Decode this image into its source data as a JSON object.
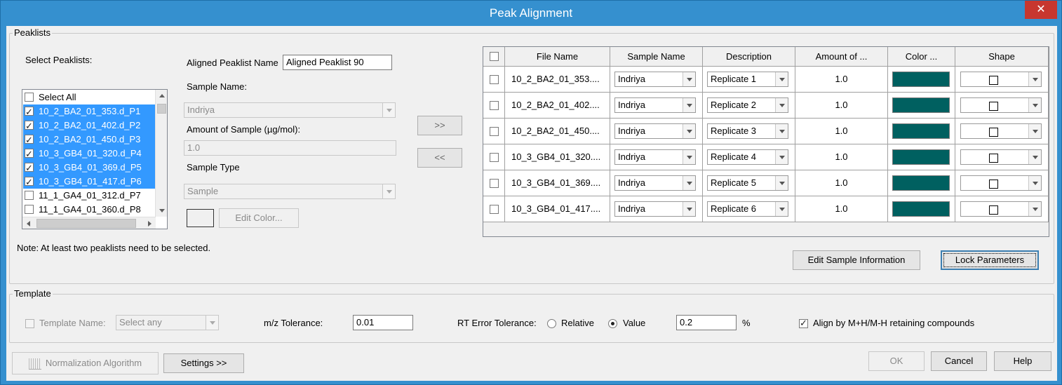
{
  "window": {
    "title": "Peak Alignment",
    "close_symbol": "✕"
  },
  "peaklists_group": {
    "label": "Peaklists",
    "select_label": "Select Peaklists:",
    "list_items": [
      {
        "label": "Select All",
        "checked": false,
        "selected": false
      },
      {
        "label": "10_2_BA2_01_353.d_P1",
        "checked": true,
        "selected": true
      },
      {
        "label": "10_2_BA2_01_402.d_P2",
        "checked": true,
        "selected": true
      },
      {
        "label": "10_2_BA2_01_450.d_P3",
        "checked": true,
        "selected": true
      },
      {
        "label": "10_3_GB4_01_320.d_P4",
        "checked": true,
        "selected": true
      },
      {
        "label": "10_3_GB4_01_369.d_P5",
        "checked": true,
        "selected": true
      },
      {
        "label": "10_3_GB4_01_417.d_P6",
        "checked": true,
        "selected": true
      },
      {
        "label": "11_1_GA4_01_312.d_P7",
        "checked": false,
        "selected": false
      },
      {
        "label": "11_1_GA4_01_360.d_P8",
        "checked": false,
        "selected": false
      }
    ],
    "aligned_name_label": "Aligned Peaklist Name",
    "aligned_name_value": "Aligned Peaklist 90",
    "sample_name_label": "Sample Name:",
    "sample_name_value": "Indriya",
    "amount_label": "Amount of Sample (µg/mol):",
    "amount_value": "1.0",
    "sample_type_label": "Sample Type",
    "sample_type_value": "Sample",
    "edit_color_label": "Edit Color...",
    "add_label": ">>",
    "remove_label": "<<",
    "note": "Note: At least two peaklists need to be selected."
  },
  "grid": {
    "headers": [
      "",
      "File Name",
      "Sample Name",
      "Description",
      "Amount of ...",
      "Color ...",
      "Shape"
    ],
    "color_hex": "#006060",
    "rows": [
      {
        "file": "10_2_BA2_01_353....",
        "sample": "Indriya",
        "description": "Replicate 1",
        "amount": "1.0"
      },
      {
        "file": "10_2_BA2_01_402....",
        "sample": "Indriya",
        "description": "Replicate 2",
        "amount": "1.0"
      },
      {
        "file": "10_2_BA2_01_450....",
        "sample": "Indriya",
        "description": "Replicate 3",
        "amount": "1.0"
      },
      {
        "file": "10_3_GB4_01_320....",
        "sample": "Indriya",
        "description": "Replicate 4",
        "amount": "1.0"
      },
      {
        "file": "10_3_GB4_01_369....",
        "sample": "Indriya",
        "description": "Replicate 5",
        "amount": "1.0"
      },
      {
        "file": "10_3_GB4_01_417....",
        "sample": "Indriya",
        "description": "Replicate 6",
        "amount": "1.0"
      }
    ],
    "edit_sample_info_label": "Edit Sample Information",
    "lock_params_label": "Lock Parameters"
  },
  "template_group": {
    "label": "Template",
    "template_name_label": "Template Name:",
    "template_name_value": "Select any",
    "mz_label": "m/z Tolerance:",
    "mz_value": "0.01",
    "rt_label": "RT Error Tolerance:",
    "relative_label": "Relative",
    "value_label": "Value",
    "rt_value": "0.2",
    "percent": "%",
    "align_label": "Align by M+H/M-H retaining compounds"
  },
  "footer": {
    "normalization_label": "Normalization Algorithm",
    "settings_label": "Settings >>",
    "ok_label": "OK",
    "cancel_label": "Cancel",
    "help_label": "Help"
  }
}
